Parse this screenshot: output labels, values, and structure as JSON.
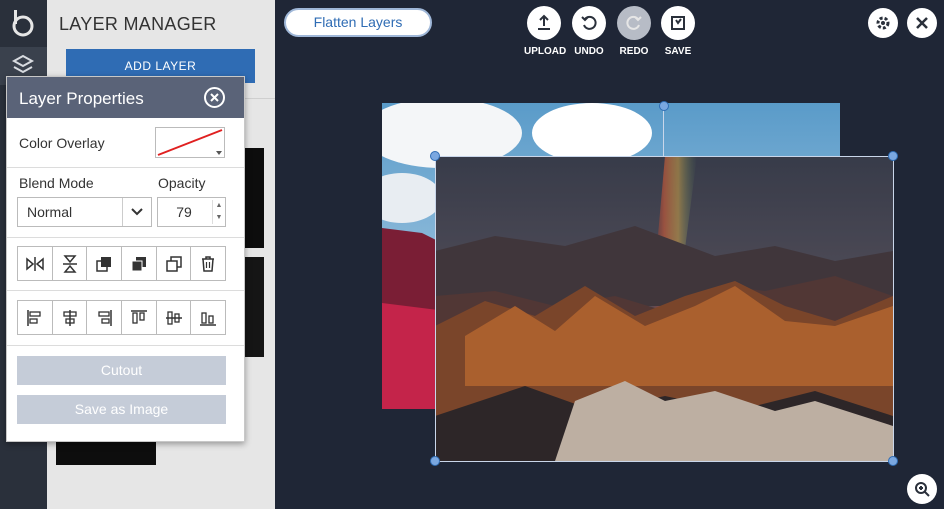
{
  "manager": {
    "title": "LAYER MANAGER",
    "add_layer_label": "ADD LAYER"
  },
  "toolbar": {
    "flatten_label": "Flatten Layers",
    "upload_label": "UPLOAD",
    "undo_label": "UNDO",
    "redo_label": "REDO",
    "save_label": "SAVE"
  },
  "props": {
    "title": "Layer Properties",
    "color_overlay_label": "Color Overlay",
    "blend_mode_label": "Blend Mode",
    "blend_mode_value": "Normal",
    "opacity_label": "Opacity",
    "opacity_value": "79",
    "cutout_label": "Cutout",
    "save_image_label": "Save as Image"
  },
  "colors": {
    "accent": "#2f6cb4",
    "panel_header": "#5a6378",
    "workspace": "#1f2636",
    "disabled_button": "#c5ccd8"
  },
  "icons": {
    "transform_row": [
      "flip-horizontal-icon",
      "flip-vertical-icon",
      "bring-forward-icon",
      "send-backward-icon",
      "duplicate-icon",
      "trash-icon"
    ],
    "align_row": [
      "align-left-icon",
      "align-center-horizontal-icon",
      "align-right-icon",
      "align-top-icon",
      "align-middle-vertical-icon",
      "align-bottom-icon"
    ]
  }
}
